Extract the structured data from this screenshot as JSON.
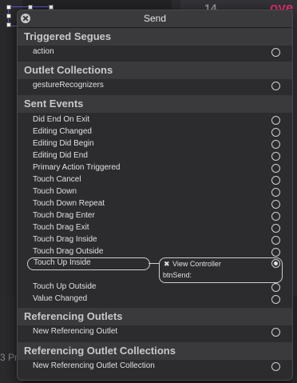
{
  "background": {
    "device_number": "14",
    "device_text": "ove",
    "bottom_text": "3 Pr"
  },
  "popover": {
    "title": "Send",
    "sections": [
      {
        "label": "Triggered Segues",
        "items": [
          "action"
        ]
      },
      {
        "label": "Outlet Collections",
        "items": [
          "gestureRecognizers"
        ]
      },
      {
        "label": "Sent Events",
        "items": [
          "Did End On Exit",
          "Editing Changed",
          "Editing Did Begin",
          "Editing Did End",
          "Primary Action Triggered",
          "Touch Cancel",
          "Touch Down",
          "Touch Down Repeat",
          "Touch Drag Enter",
          "Touch Drag Exit",
          "Touch Drag Inside",
          "Touch Drag Outside",
          "Touch Up Inside",
          "Touch Up Outside",
          "Value Changed"
        ]
      },
      {
        "label": "Referencing Outlets",
        "items": [
          "New Referencing Outlet"
        ]
      },
      {
        "label": "Referencing Outlet Collections",
        "items": [
          "New Referencing Outlet Collection"
        ]
      }
    ],
    "connection": {
      "event": "Touch Up Inside",
      "target": "View Controller",
      "action": "btnSend:",
      "remove_glyph": "✖"
    }
  }
}
